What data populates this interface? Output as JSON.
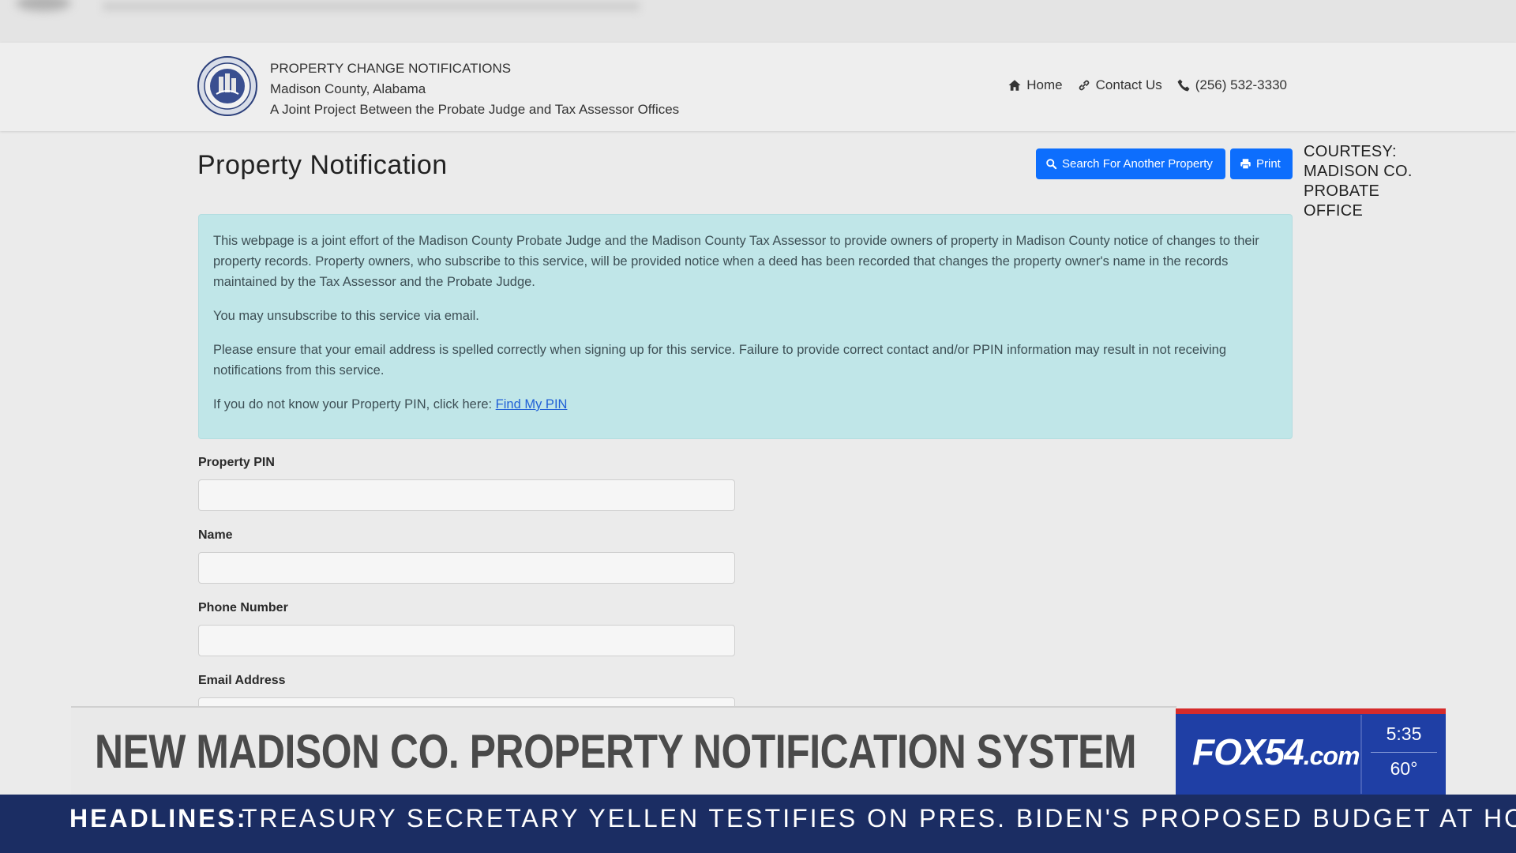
{
  "header": {
    "title": "PROPERTY CHANGE NOTIFICATIONS",
    "county": "Madison County, Alabama",
    "subtitle": "A Joint Project Between the Probate Judge and Tax Assessor Offices",
    "nav": {
      "home": "Home",
      "contact": "Contact Us",
      "phone": "(256) 532-3330"
    }
  },
  "page": {
    "title": "Property Notification",
    "search_button": "Search For Another Property",
    "print_button": "Print"
  },
  "courtesy": "COURTESY: MADISON CO. PROBATE OFFICE",
  "info": {
    "p1": "This webpage is a joint effort of the Madison County Probate Judge and the Madison County Tax Assessor to provide owners of property in Madison County notice of changes to their property records. Property owners, who subscribe to this service, will be provided notice when a deed has been recorded that changes the property owner's name in the records maintained by the Tax Assessor and the Probate Judge.",
    "p2": "You may unsubscribe to this service via email.",
    "p3": "Please ensure that your email address is spelled correctly when signing up for this service. Failure to provide correct contact and/or PPIN information may result in not receiving notifications from this service.",
    "p4_prefix": "If you do not know your Property PIN, click here: ",
    "p4_link": "Find My PIN"
  },
  "form": {
    "pin_label": "Property PIN",
    "name_label": "Name",
    "phone_label": "Phone Number",
    "email_label": "Email Address"
  },
  "broadcast": {
    "lower_third": "NEW MADISON CO. PROPERTY NOTIFICATION SYSTEM",
    "logo": "FOX54",
    "logo_suffix": ".com",
    "time": "5:35",
    "temperature": "60°",
    "ticker_label": "HEADLINES:",
    "ticker_text": "TREASURY SECRETARY YELLEN TESTIFIES ON PRES. BIDEN'S PROPOSED BUDGET AT HOUSE HE"
  },
  "colors": {
    "primary_button": "#0d6efd",
    "info_background": "#c0e6e8",
    "brand_blue": "#1f3fa5",
    "brand_red": "#d52b2b",
    "ticker_background": "#1b2d63"
  },
  "icons": [
    "home-icon",
    "link-icon",
    "phone-icon",
    "search-icon",
    "print-icon",
    "county-seal"
  ]
}
